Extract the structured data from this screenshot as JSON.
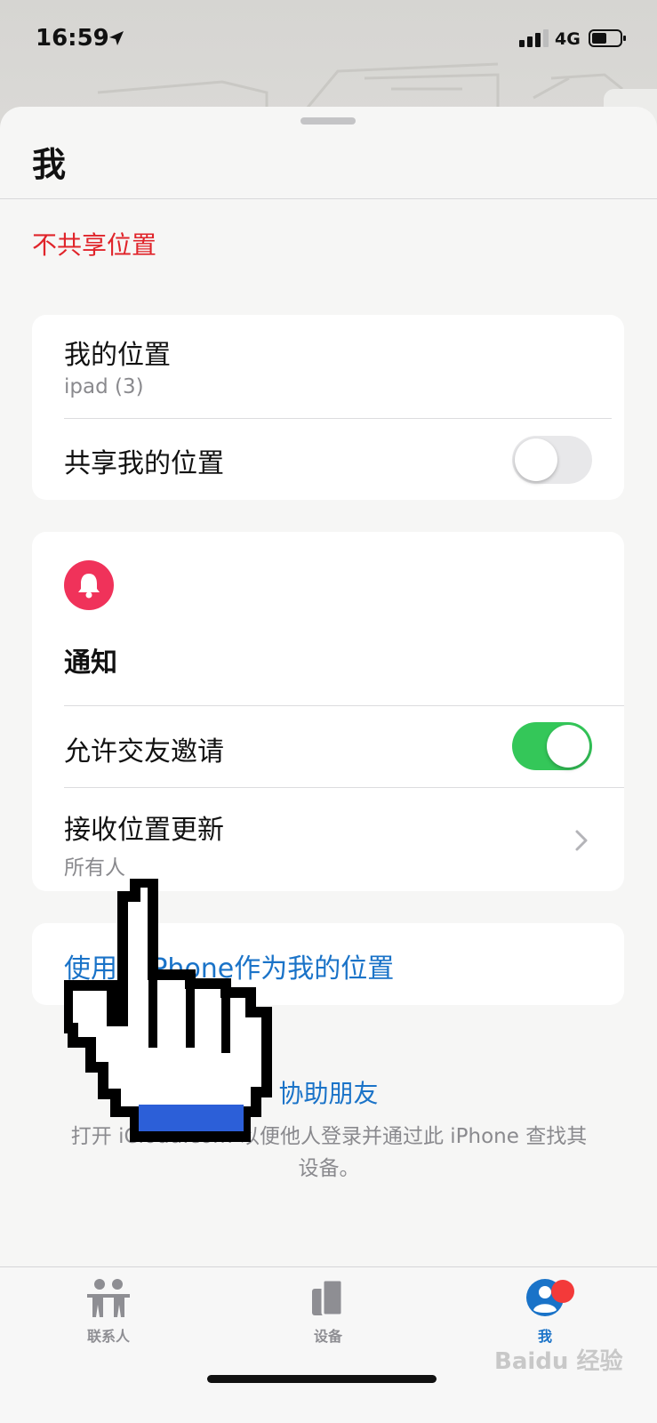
{
  "status_bar": {
    "time": "16:59",
    "network": "4G"
  },
  "sheet": {
    "title": "我",
    "stop_sharing_label": "不共享位置",
    "my_location_card": {
      "title": "我的位置",
      "device": "ipad (3)",
      "share_label": "共享我的位置",
      "share_enabled": false
    },
    "notifications_card": {
      "icon": "bell-icon",
      "title": "通知",
      "allow_invites_label": "允许交友邀请",
      "allow_invites_enabled": true,
      "receive_updates_label": "接收位置更新",
      "receive_updates_value": "所有人"
    },
    "use_iphone_label": "使用此iPhone作为我的位置",
    "help_friend_label": "协助朋友",
    "help_friend_desc": "打开 iCloud.com 以便他人登录并通过此 iPhone 查找其设备。"
  },
  "tab_bar": {
    "tabs": [
      {
        "label": "联系人",
        "icon": "people-icon",
        "active": false
      },
      {
        "label": "设备",
        "icon": "devices-icon",
        "active": false
      },
      {
        "label": "我",
        "icon": "person-circle-icon",
        "active": true
      }
    ]
  },
  "watermark": "Baidu 经验",
  "colors": {
    "accent_blue": "#1a73c8",
    "destructive_red": "#e0242a",
    "toggle_green": "#34c759",
    "bell_pink": "#f0325a"
  }
}
